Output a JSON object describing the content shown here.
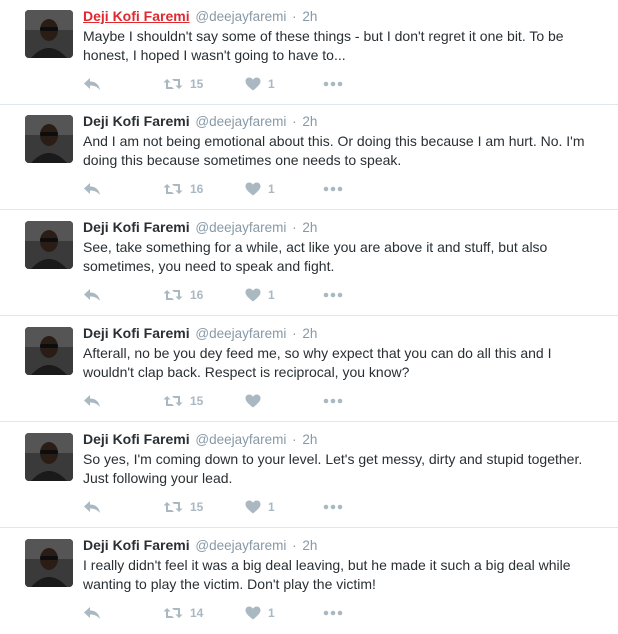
{
  "colors": {
    "name": "#292f33",
    "name_hover": "#e0282e",
    "meta": "#8899a6",
    "action": "#aab8c2",
    "divider": "#e1e8ed"
  },
  "icons": {
    "reply": "reply-icon",
    "retweet": "retweet-icon",
    "like": "heart-icon",
    "more": "more-dots-icon"
  },
  "tweets": [
    {
      "name": "Deji Kofi Faremi",
      "handle": "@deejayfaremi",
      "sep": "·",
      "time": "2h",
      "text": "Maybe I shouldn't say some of these things - but I don't regret it one bit. To be honest, I hoped I wasn't going to have to...",
      "retweets": "15",
      "likes": "1"
    },
    {
      "name": "Deji Kofi Faremi",
      "handle": "@deejayfaremi",
      "sep": "·",
      "time": "2h",
      "text": "And I am not being emotional about this. Or doing this because I am hurt. No. I'm doing this because sometimes one needs to speak.",
      "retweets": "16",
      "likes": "1"
    },
    {
      "name": "Deji Kofi Faremi",
      "handle": "@deejayfaremi",
      "sep": "·",
      "time": "2h",
      "text": "See, take something for a while, act like you are above it and stuff, but also sometimes, you need to speak and fight.",
      "retweets": "16",
      "likes": "1"
    },
    {
      "name": "Deji Kofi Faremi",
      "handle": "@deejayfaremi",
      "sep": "·",
      "time": "2h",
      "text": "Afterall, no be you dey feed me, so why expect that you can do all this and I wouldn't clap back. Respect is reciprocal, you know?",
      "retweets": "15",
      "likes": ""
    },
    {
      "name": "Deji Kofi Faremi",
      "handle": "@deejayfaremi",
      "sep": "·",
      "time": "2h",
      "text": "So yes, I'm coming down to your level. Let's get messy, dirty and stupid together. Just following your lead.",
      "retweets": "15",
      "likes": "1"
    },
    {
      "name": "Deji Kofi Faremi",
      "handle": "@deejayfaremi",
      "sep": "·",
      "time": "2h",
      "text": "I really didn't feel it was a big deal leaving, but he made it such a big deal while wanting to play the victim. Don't play the victim!",
      "retweets": "14",
      "likes": "1"
    }
  ]
}
